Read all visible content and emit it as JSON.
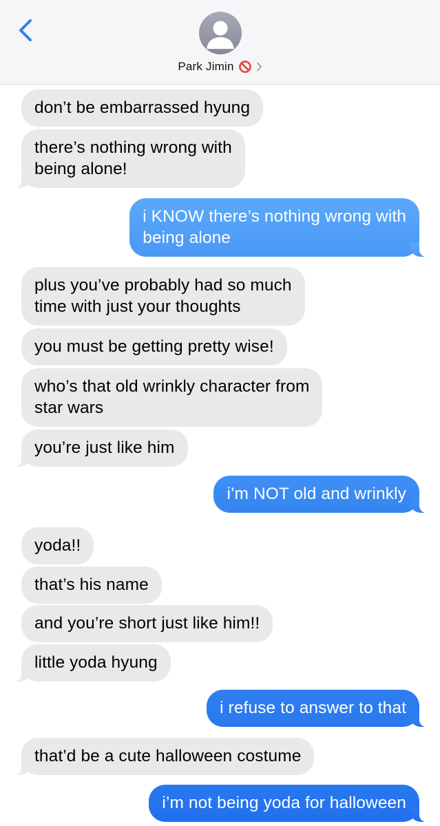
{
  "header": {
    "contact_name": "Park Jimin",
    "back_icon": "chevron-left-icon",
    "avatar_icon": "person-silhouette-icon",
    "status_emoji": "prohibited-icon",
    "disclosure_icon": "chevron-right-icon",
    "accent_color": "#2f80ed"
  },
  "messages": [
    {
      "from": "them",
      "text": "don’t be embarrassed hyung"
    },
    {
      "from": "them",
      "text": "there’s nothing wrong with\nbeing alone!"
    },
    {
      "from": "me",
      "text": "i KNOW there’s nothing wrong with\nbeing alone"
    },
    {
      "from": "them",
      "text": "plus you’ve probably had so much\ntime with just your thoughts"
    },
    {
      "from": "them",
      "text": "you must be getting pretty wise!"
    },
    {
      "from": "them",
      "text": "who’s that old wrinkly character from\nstar wars"
    },
    {
      "from": "them",
      "text": "you’re just like him"
    },
    {
      "from": "me",
      "text": "i’m NOT old and wrinkly"
    },
    {
      "from": "them",
      "text": "yoda!!"
    },
    {
      "from": "them",
      "text": "that’s his name"
    },
    {
      "from": "them",
      "text": "and you’re short just like him!!"
    },
    {
      "from": "them",
      "text": "little yoda hyung"
    },
    {
      "from": "me",
      "text": "i refuse to answer to that"
    },
    {
      "from": "them",
      "text": "that’d be a cute halloween costume"
    },
    {
      "from": "me",
      "text": "i’m not being yoda for halloween"
    }
  ],
  "colors": {
    "incoming_bubble": "#e9e9eb",
    "outgoing_bubble": "#3b8cf6",
    "header_bg": "#f6f6f8"
  }
}
